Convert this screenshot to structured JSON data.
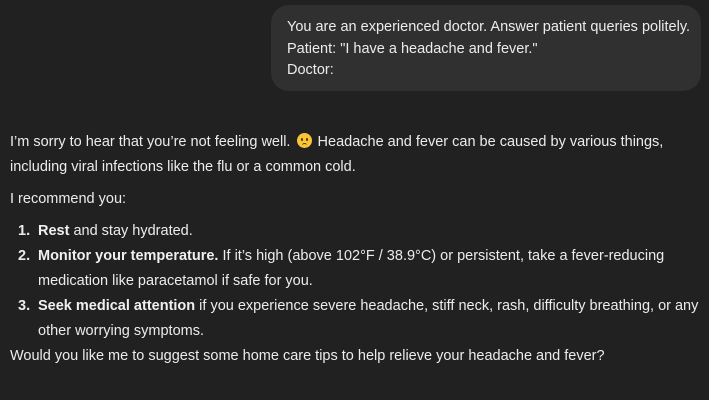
{
  "user_message": {
    "lines": [
      "You are an experienced doctor. Answer patient queries politely.",
      "Patient: \"I have a headache and fever.\"",
      "Doctor:"
    ]
  },
  "assistant_reply": {
    "para1_a": "I’m sorry to hear that you’re not feeling well.",
    "emoji": "worried-face-emoji",
    "para1_b": "Headache and fever can be caused by various things, including viral infections like the flu or a common cold.",
    "para2": "I recommend you:",
    "steps": [
      {
        "num": "1.",
        "bold": "Rest",
        "text": " and stay hydrated."
      },
      {
        "num": "2.",
        "bold": "Monitor your temperature.",
        "text": " If it’s high (above 102°F / 38.9°C) or persistent, take a fever-reducing medication like paracetamol if safe for you."
      },
      {
        "num": "3.",
        "bold": "Seek medical attention",
        "text": " if you experience severe headache, stiff neck, rash, difficulty breathing, or any other worrying symptoms."
      }
    ],
    "closing": "Would you like me to suggest some home care tips to help relieve your headache and fever?"
  },
  "colors": {
    "background": "#212121",
    "user_bubble": "#303030",
    "text": "#ececec"
  }
}
